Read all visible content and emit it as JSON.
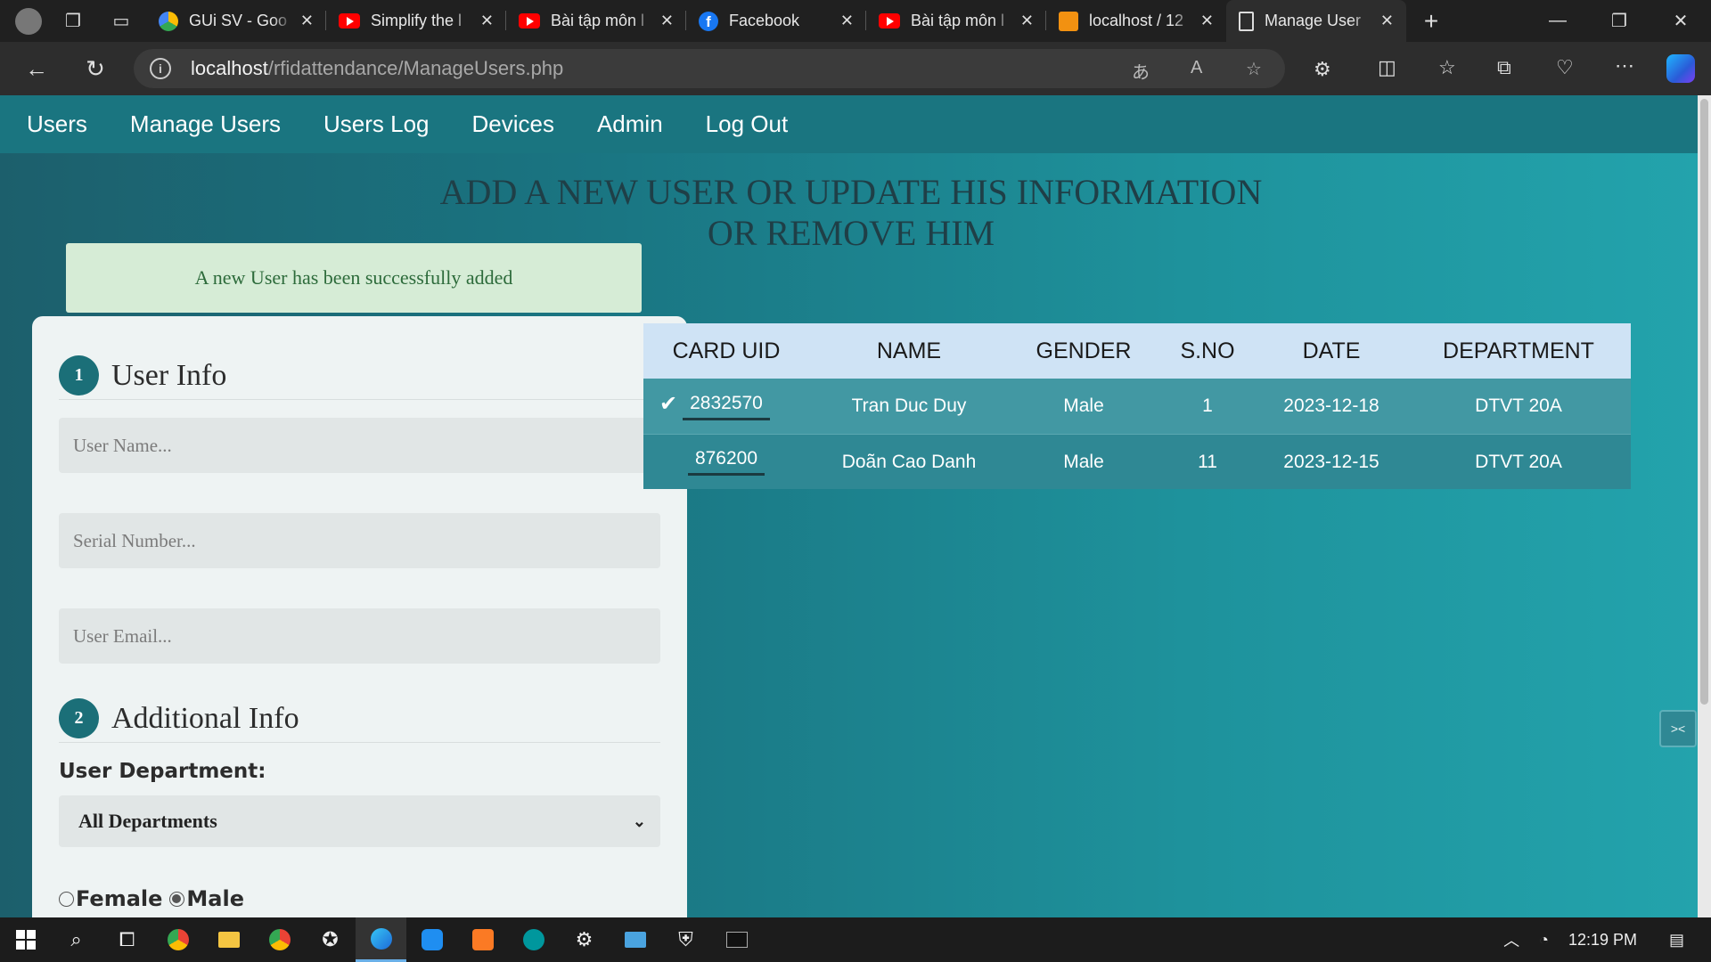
{
  "browser": {
    "tabs": [
      {
        "label": "GUi SV - Goo",
        "icon": "drive-icon"
      },
      {
        "label": "Simplify the l",
        "icon": "youtube-icon"
      },
      {
        "label": "Bài tập môn l",
        "icon": "youtube-icon"
      },
      {
        "label": "Facebook",
        "icon": "facebook-icon"
      },
      {
        "label": "Bài tập môn l",
        "icon": "youtube-icon"
      },
      {
        "label": "localhost / 12",
        "icon": "phpmyadmin-icon"
      },
      {
        "label": "Manage User",
        "icon": "page-icon",
        "active": true
      }
    ],
    "url_host": "localhost",
    "url_path": "/rfidattendance/ManageUsers.php"
  },
  "nav": {
    "items": [
      "Users",
      "Manage Users",
      "Users Log",
      "Devices",
      "Admin",
      "Log Out"
    ]
  },
  "page": {
    "heading_line1": "ADD A NEW USER OR UPDATE HIS INFORMATION",
    "heading_line2": "OR REMOVE HIM",
    "alert": "A new User has been successfully added"
  },
  "form": {
    "section1_num": "1",
    "section1_title": "User Info",
    "username_placeholder": "User Name...",
    "serial_placeholder": "Serial Number...",
    "email_placeholder": "User Email...",
    "section2_num": "2",
    "section2_title": "Additional Info",
    "dept_label": "User Department:",
    "dept_selected": "All Departments",
    "gender_female": "Female",
    "gender_male": "Male",
    "gender_selected": "Male"
  },
  "table": {
    "headers": [
      "CARD UID",
      "NAME",
      "GENDER",
      "S.NO",
      "DATE",
      "DEPARTMENT"
    ],
    "rows": [
      {
        "uid": "2832570",
        "name": "Tran Duc Duy",
        "gender": "Male",
        "sno": "1",
        "date": "2023-12-18",
        "dept": "DTVT 20A",
        "selected": true
      },
      {
        "uid": "876200",
        "name": "Doãn Cao Danh",
        "gender": "Male",
        "sno": "11",
        "date": "2023-12-15",
        "dept": "DTVT 20A",
        "selected": false
      }
    ]
  },
  "taskbar": {
    "time": "12:19 PM"
  },
  "colors": {
    "nav_bg": "#1a7580",
    "page_bg": "#1a7582",
    "table_header": "#cfe3f5",
    "row_selected": "#4298a3",
    "alert_bg": "#d6ecd6"
  }
}
